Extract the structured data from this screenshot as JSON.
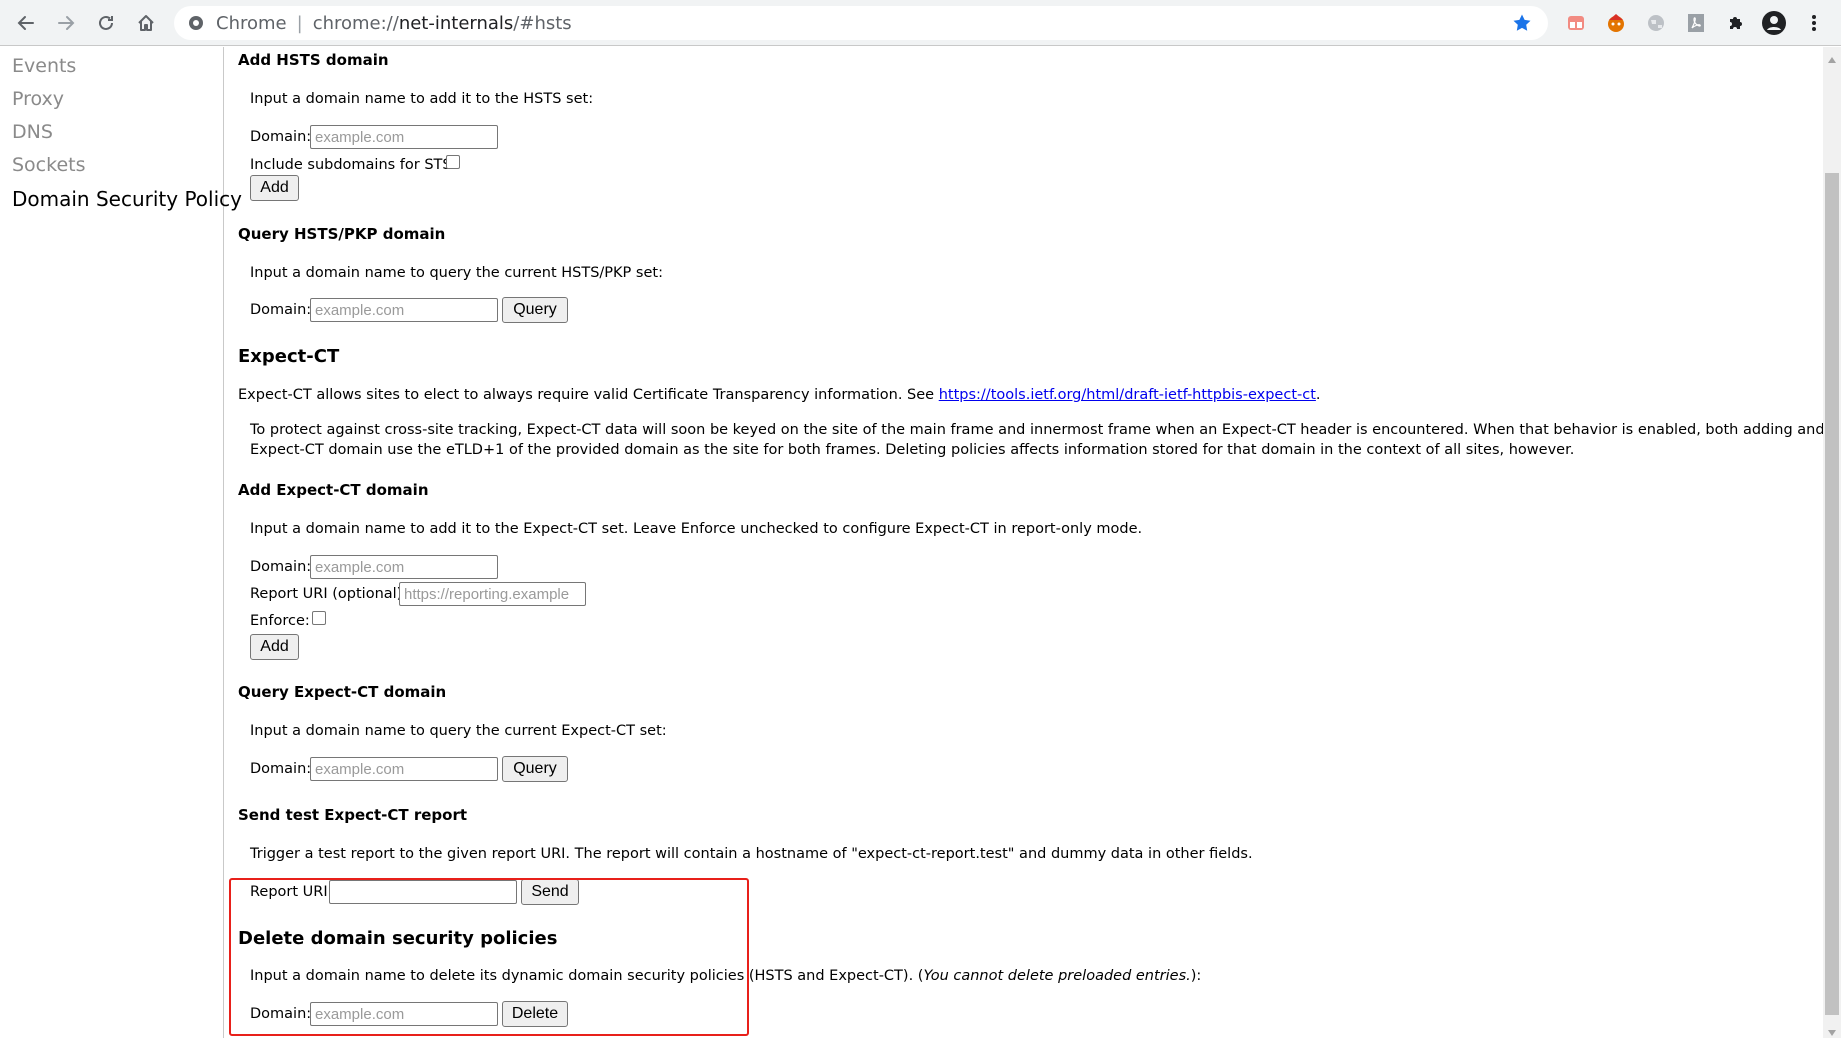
{
  "browser": {
    "scheme_label": "Chrome",
    "separator": "|",
    "url_prefix": "chrome://",
    "url_host": "net-internals",
    "url_path": "/#hsts",
    "icons": [
      "back-arrow-icon",
      "forward-arrow-icon",
      "reload-icon",
      "home-icon",
      "star-icon",
      "extension-tab-icon",
      "extension-mascot-icon",
      "extension-globe-icon",
      "extension-pdf-icon",
      "puzzle-icon",
      "profile-avatar-icon",
      "more-menu-icon"
    ]
  },
  "sidebar": {
    "items": [
      {
        "label": "Events"
      },
      {
        "label": "Proxy"
      },
      {
        "label": "DNS"
      },
      {
        "label": "Sockets"
      },
      {
        "label": "Domain Security Policy"
      }
    ]
  },
  "add_hsts": {
    "title": "Add HSTS domain",
    "desc": "Input a domain name to add it to the HSTS set:",
    "domain_label": "Domain:",
    "domain_placeholder": "example.com",
    "subdomains_label": "Include subdomains for STS:",
    "add_button": "Add"
  },
  "query_hsts": {
    "title": "Query HSTS/PKP domain",
    "desc": "Input a domain name to query the current HSTS/PKP set:",
    "domain_label": "Domain:",
    "domain_placeholder": "example.com",
    "query_button": "Query"
  },
  "expect_ct": {
    "title": "Expect-CT",
    "desc_prefix": "Expect-CT allows sites to elect to always require valid Certificate Transparency information. See ",
    "desc_link": "https://tools.ietf.org/html/draft-ietf-httpbis-expect-ct",
    "desc_suffix": ".",
    "note_line1": "To protect against cross-site tracking, Expect-CT data will soon be keyed on the site of the main frame and innermost frame when an Expect-CT header is encountered. When that behavior is enabled, both adding and querying an",
    "note_line2": "Expect-CT domain use the eTLD+1 of the provided domain as the site for both frames. Deleting policies affects information stored for that domain in the context of all sites, however."
  },
  "add_expect_ct": {
    "title": "Add Expect-CT domain",
    "desc": "Input a domain name to add it to the Expect-CT set. Leave Enforce unchecked to configure Expect-CT in report-only mode.",
    "domain_label": "Domain:",
    "domain_placeholder": "example.com",
    "report_label": "Report URI (optional):",
    "report_placeholder": "https://reporting.example",
    "enforce_label": "Enforce:",
    "add_button": "Add"
  },
  "query_expect_ct": {
    "title": "Query Expect-CT domain",
    "desc": "Input a domain name to query the current Expect-CT set:",
    "domain_label": "Domain:",
    "domain_placeholder": "example.com",
    "query_button": "Query"
  },
  "send_test": {
    "title": "Send test Expect-CT report",
    "desc": "Trigger a test report to the given report URI. The report will contain a hostname of \"expect-ct-report.test\" and dummy data in other fields.",
    "report_label": "Report URI:",
    "report_value": "",
    "send_button": "Send"
  },
  "delete_policies": {
    "title": "Delete domain security policies",
    "desc": "Input a domain name to delete its dynamic domain security policies (HSTS and Expect-CT). (",
    "desc_italic": "You cannot delete preloaded entries.",
    "desc_end": "):",
    "domain_label": "Domain:",
    "domain_placeholder": "example.com",
    "delete_button": "Delete"
  },
  "colors": {
    "highlight_border": "#e8201a",
    "link": "#0000ee",
    "star": "#1a73e8"
  }
}
